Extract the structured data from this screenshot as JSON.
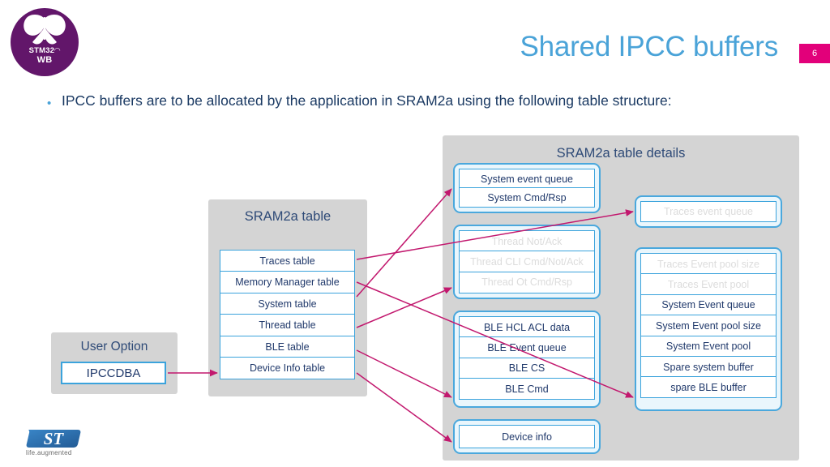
{
  "slide": {
    "title": "Shared IPCC buffers",
    "page_number": "6",
    "accent_title_color": "#4aa3d8",
    "badge_color": "#e2007a",
    "arrow_color": "#c2186e",
    "cell_border_color": "#3ba3dc",
    "panel_color": "#d4d4d4",
    "text_color": "#20396b"
  },
  "logo": {
    "name": "STM32WB",
    "line1_brand": "STM32",
    "line1_wave": "»",
    "line2": "WB",
    "color": "#62166a"
  },
  "st_logo": {
    "mark": "ST",
    "tagline": "life.augmented"
  },
  "bullet": {
    "marker": "•",
    "text": "IPCC buffers are to be allocated by the application in SRAM2a using the following table structure:"
  },
  "sram_table_panel": {
    "title": "SRAM2a table",
    "rows": [
      {
        "label": "Traces table",
        "muted": true
      },
      {
        "label": "Memory Manager table",
        "muted": false
      },
      {
        "label": "System table",
        "muted": false
      },
      {
        "label": "Thread table",
        "muted": true
      },
      {
        "label": "BLE table",
        "muted": false
      },
      {
        "label": "Device Info table",
        "muted": false
      }
    ]
  },
  "user_option_panel": {
    "title": "User Option",
    "field_value": "IPCCDBA"
  },
  "details_panel": {
    "title": "SRAM2a table details",
    "groups": [
      {
        "name": "system-group",
        "rows": [
          {
            "label": "System event queue",
            "muted": false
          },
          {
            "label": "System Cmd/Rsp",
            "muted": false
          }
        ]
      },
      {
        "name": "thread-group",
        "rows": [
          {
            "label": "Thread Not/Ack",
            "muted": true
          },
          {
            "label": "Thread CLI Cmd/Not/Ack",
            "muted": true
          },
          {
            "label": "Thread Ot Cmd/Rsp",
            "muted": true
          }
        ]
      },
      {
        "name": "ble-group",
        "rows": [
          {
            "label": "BLE HCL ACL data",
            "muted": false
          },
          {
            "label": "BLE Event queue",
            "muted": false
          },
          {
            "label": "BLE CS",
            "muted": false
          },
          {
            "label": "BLE Cmd",
            "muted": false
          }
        ]
      },
      {
        "name": "device-info-group",
        "rows": [
          {
            "label": "Device info",
            "muted": false
          }
        ]
      },
      {
        "name": "traces-group",
        "rows": [
          {
            "label": "Traces event queue",
            "muted": true
          }
        ]
      },
      {
        "name": "memory-manager-group",
        "rows": [
          {
            "label": "Traces Event pool size",
            "muted": true
          },
          {
            "label": "Traces Event pool",
            "muted": true
          },
          {
            "label": "System Event queue",
            "muted": false
          },
          {
            "label": "System Event pool size",
            "muted": false
          },
          {
            "label": "System Event pool",
            "muted": false
          },
          {
            "label": "Spare system buffer",
            "muted": false
          },
          {
            "label": "spare BLE buffer",
            "muted": false
          }
        ]
      }
    ]
  },
  "connections": [
    {
      "from": "Traces table",
      "to": "traces-group"
    },
    {
      "from": "Memory Manager table",
      "to": "memory-manager-group"
    },
    {
      "from": "System table",
      "to": "system-group"
    },
    {
      "from": "Thread table",
      "to": "thread-group"
    },
    {
      "from": "BLE table",
      "to": "ble-group"
    },
    {
      "from": "Device Info table",
      "to": "device-info-group"
    },
    {
      "from": "IPCCDBA",
      "to": "Device Info table"
    }
  ]
}
